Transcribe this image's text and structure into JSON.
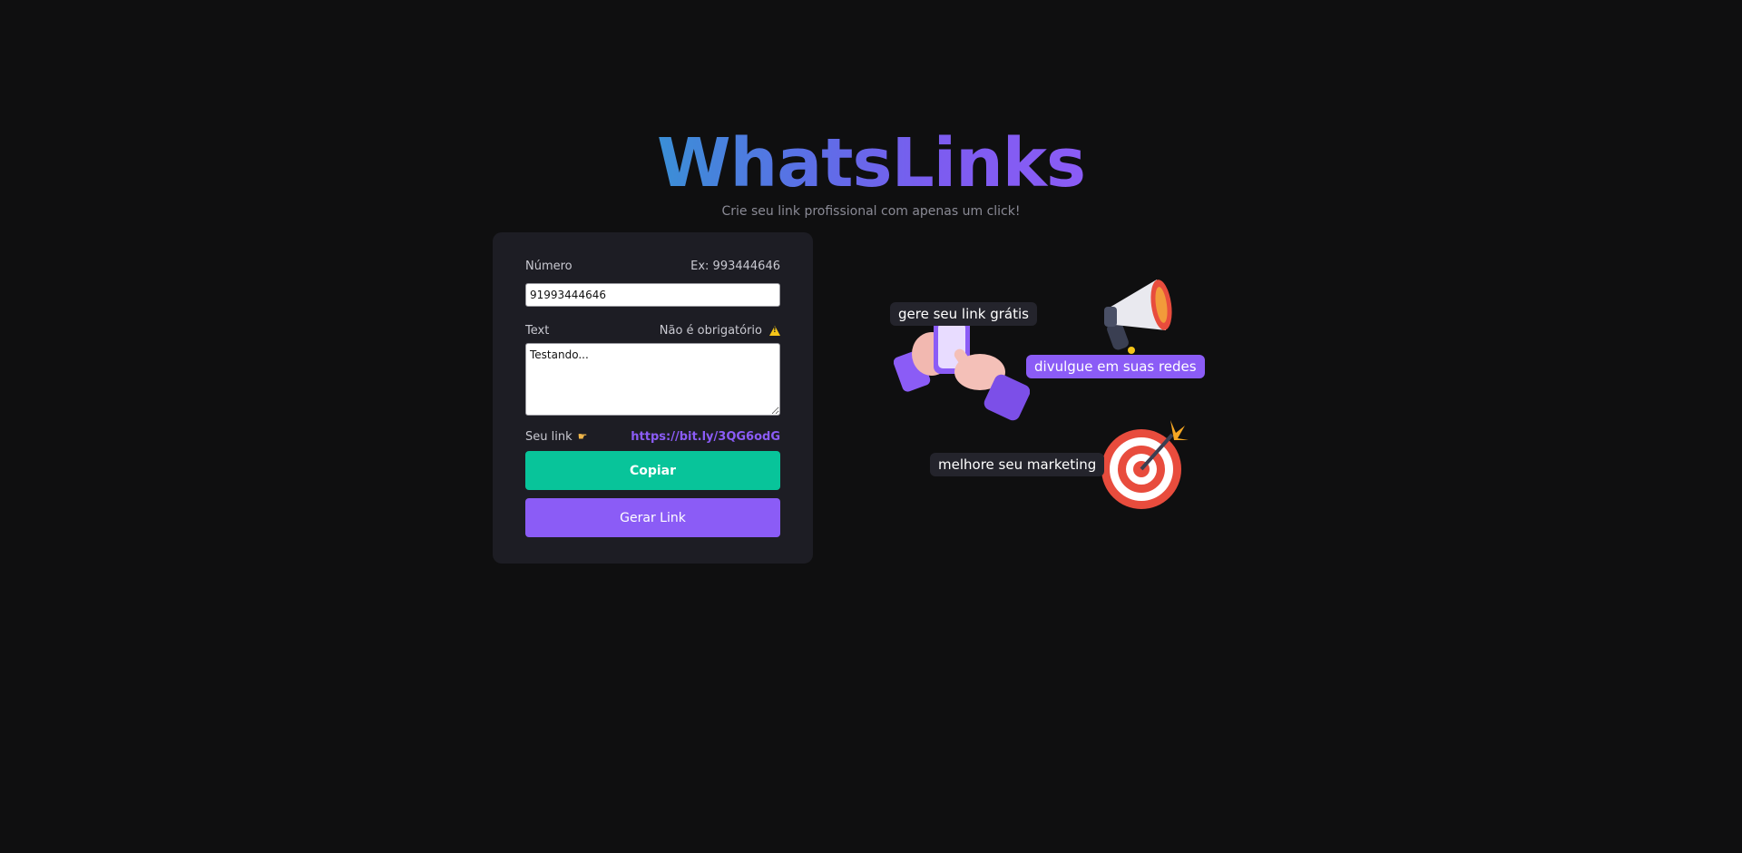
{
  "header": {
    "title": "WhatsLinks",
    "subtitle": "Crie seu link profissional com apenas um click!"
  },
  "form": {
    "numero_label": "Número",
    "numero_example": "Ex: 993444646",
    "numero_value": "91993444646",
    "text_label": "Text",
    "text_hint": "Não é obrigatório",
    "text_value": "Testando...",
    "link_label": "Seu link",
    "link_value": "https://bit.ly/3QG6odG",
    "copy_button": "Copiar",
    "generate_button": "Gerar Link"
  },
  "illustration": {
    "tag_1": "gere seu link grátis",
    "tag_2": "divulgue em suas redes",
    "tag_3": "melhore seu marketing"
  },
  "colors": {
    "background": "#0f0f10",
    "card": "#1d1d24",
    "accent_purple": "#8b5cf6",
    "accent_green": "#08c49a",
    "warning": "#f5c518"
  }
}
